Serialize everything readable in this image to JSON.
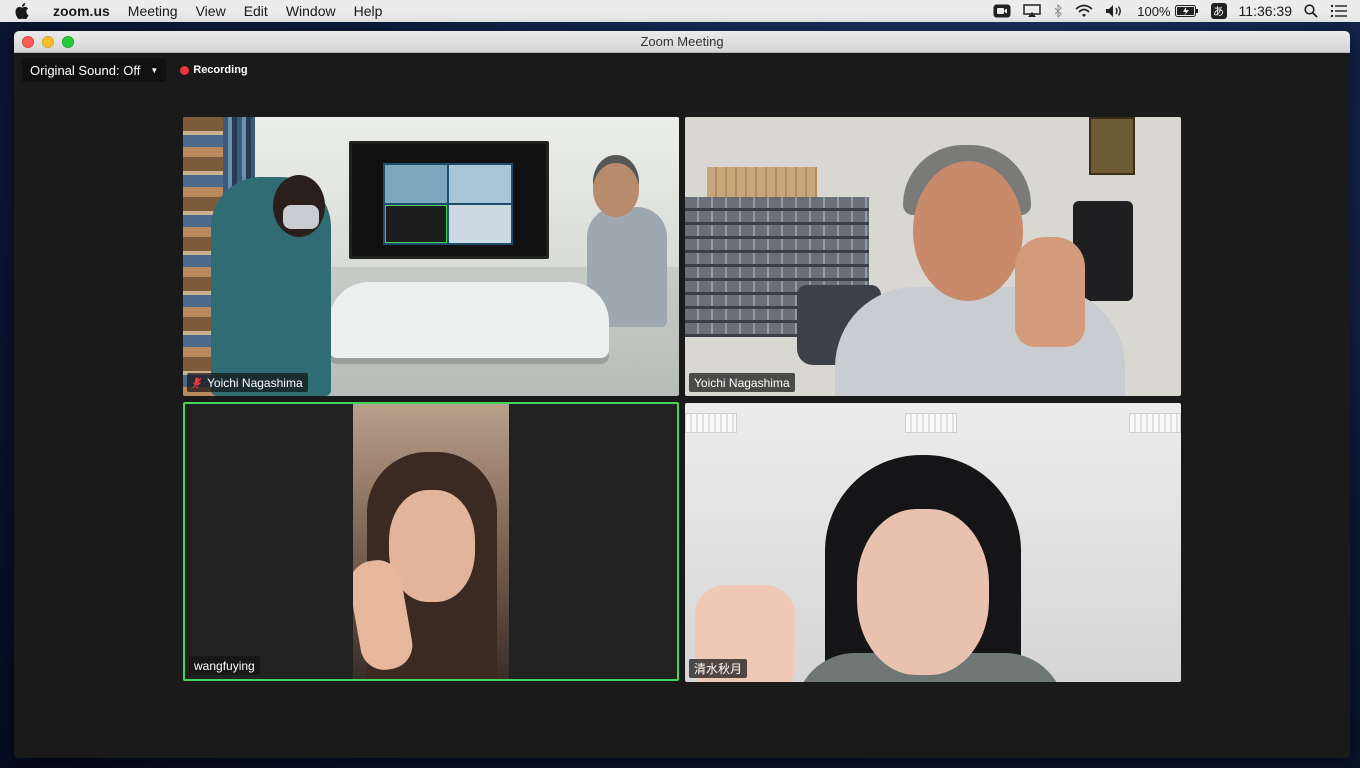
{
  "menubar": {
    "app_name": "zoom.us",
    "items": [
      "Meeting",
      "View",
      "Edit",
      "Window",
      "Help"
    ],
    "battery_percent": "100%",
    "ime_char": "あ",
    "clock": "11:36:39"
  },
  "window": {
    "title": "Zoom Meeting"
  },
  "toolbar": {
    "sound_label": "Original Sound: Off",
    "recording_label": "Recording"
  },
  "participants": [
    {
      "name": "Yoichi Nagashima",
      "muted": true,
      "active_speaker": false
    },
    {
      "name": "Yoichi Nagashima",
      "muted": false,
      "active_speaker": false
    },
    {
      "name": "wangfuying",
      "muted": false,
      "active_speaker": true
    },
    {
      "name": "清水秋月",
      "muted": false,
      "active_speaker": false
    }
  ],
  "colors": {
    "active_speaker_border": "#43d55a",
    "recording_dot": "#e8383d",
    "mute_icon": "#e8383d"
  }
}
